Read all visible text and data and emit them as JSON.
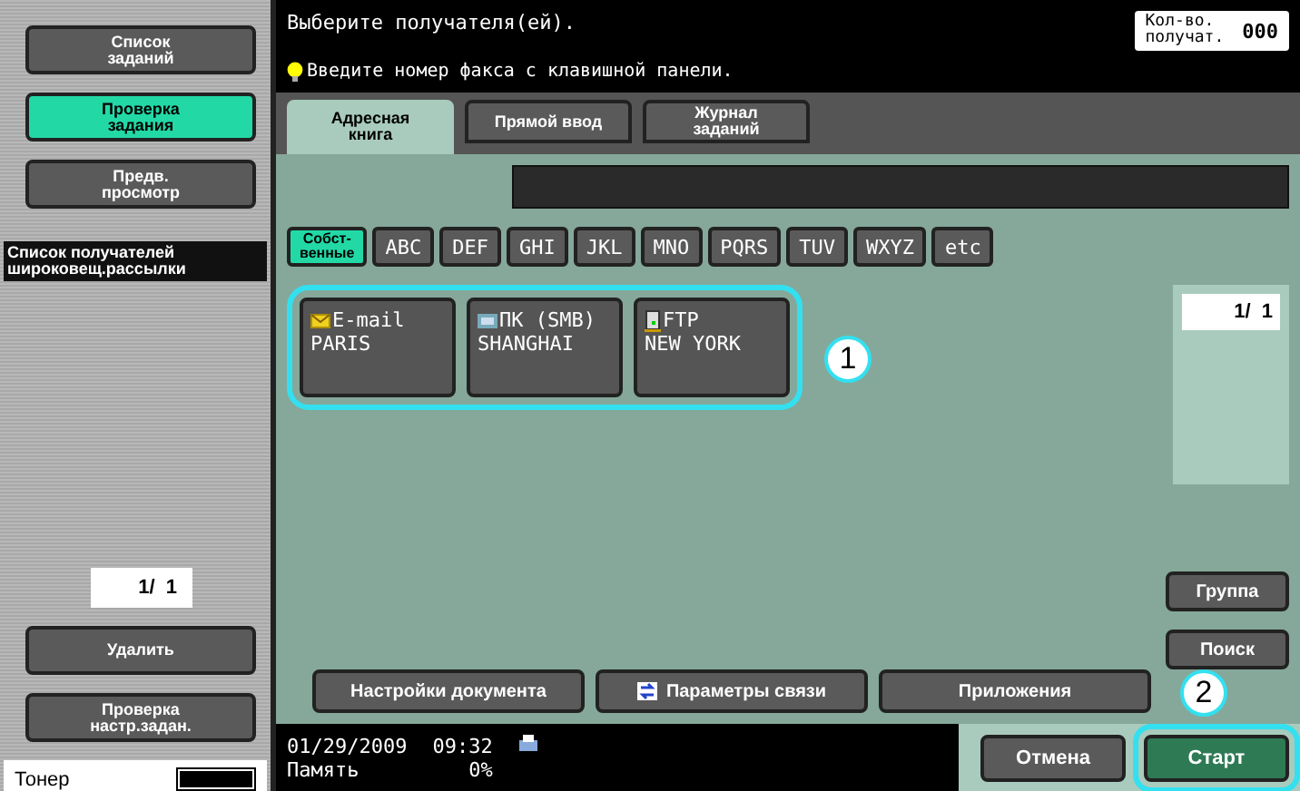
{
  "sidebar": {
    "buttons": [
      {
        "label": "Список\nзаданий",
        "selected": false
      },
      {
        "label": "Проверка\nзадания",
        "selected": true
      },
      {
        "label": "Предв.\nпросмотр",
        "selected": false
      }
    ],
    "broadcast_label": "Список получателей\nшироковещ.рассылки",
    "page": "1/  1",
    "delete_button": "Удалить",
    "check_button": "Проверка\nнастр.задан.",
    "toner": {
      "label": "Тонер",
      "level": 1
    }
  },
  "header": {
    "title": "Выберите получателя(ей).",
    "hint": "Введите номер факса с клавишной панели.",
    "count_label": "Кол-во.\nполучат.",
    "count": "000"
  },
  "tabs": [
    {
      "label": "Адресная\nкнига",
      "selected": true
    },
    {
      "label": "Прямой ввод",
      "selected": false
    },
    {
      "label": "Журнал\nзаданий",
      "selected": false
    }
  ],
  "index_tabs": [
    {
      "label": "Собст-\nвенные",
      "selected": true
    },
    {
      "label": "ABC",
      "selected": false
    },
    {
      "label": "DEF",
      "selected": false
    },
    {
      "label": "GHI",
      "selected": false
    },
    {
      "label": "JKL",
      "selected": false
    },
    {
      "label": "MNO",
      "selected": false
    },
    {
      "label": "PQRS",
      "selected": false
    },
    {
      "label": "TUV",
      "selected": false
    },
    {
      "label": "WXYZ",
      "selected": false
    },
    {
      "label": "etc",
      "selected": false
    }
  ],
  "destinations": [
    {
      "kind": "email",
      "type_label": "E-mail",
      "name": "PARIS"
    },
    {
      "kind": "smb",
      "type_label": "ПК (SMB)",
      "name": "SHANGHAI"
    },
    {
      "kind": "ftp",
      "type_label": "FTP",
      "name": "NEW YORK"
    }
  ],
  "page": "1/  1",
  "side_buttons": [
    "Группа",
    "Поиск"
  ],
  "bottom_buttons": [
    {
      "label": "Настройки документа",
      "kind": "plain"
    },
    {
      "label": "Параметры связи",
      "kind": "icon"
    },
    {
      "label": "Приложения",
      "kind": "plain"
    }
  ],
  "status": {
    "date": "01/29/2009",
    "time": "09:32",
    "memory_label": "Память",
    "memory": "0%"
  },
  "actions": [
    {
      "label": "Отмена",
      "kind": "cancel"
    },
    {
      "label": "Старт",
      "kind": "start"
    }
  ],
  "callouts": [
    "1",
    "2"
  ]
}
